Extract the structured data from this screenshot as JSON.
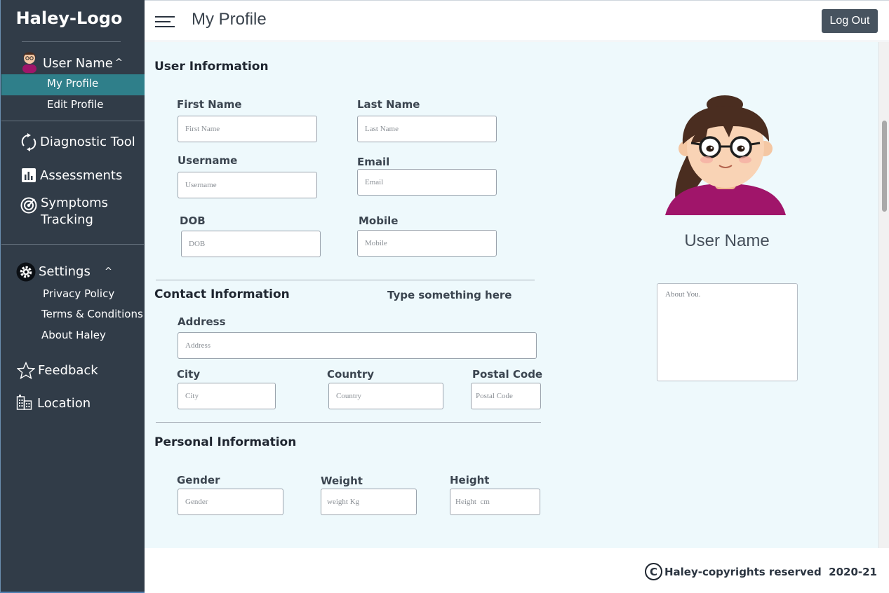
{
  "app": {
    "logo": "Haley-Logo"
  },
  "sidebar": {
    "user": {
      "name": "User Name",
      "caret": "^"
    },
    "profile_items": [
      {
        "label": "My Profile",
        "active": true
      },
      {
        "label": "Edit Profile",
        "active": false
      }
    ],
    "nav": [
      {
        "label": "Diagnostic Tool",
        "icon": "refresh-icon"
      },
      {
        "label": "Assessments",
        "icon": "bar-chart-icon"
      },
      {
        "label": "Symptoms",
        "icon": "radar-icon"
      },
      {
        "label": "Tracking"
      }
    ],
    "settings": {
      "label": "Settings",
      "caret": "^",
      "items": [
        {
          "label": "Privacy Policy"
        },
        {
          "label": "Terms & Conditions"
        },
        {
          "label": "About Haley"
        }
      ]
    },
    "feedback": {
      "label": "Feedback",
      "icon": "star-icon"
    },
    "location": {
      "label": "Location",
      "icon": "building-icon"
    }
  },
  "header": {
    "title": "My Profile",
    "logout_label": "Log Out",
    "menu_icon": "hamburger-icon"
  },
  "user_info": {
    "title": "User Information",
    "fields": {
      "first_name": {
        "label": "First Name",
        "placeholder": "First Name"
      },
      "last_name": {
        "label": "Last Name",
        "placeholder": "Last Name"
      },
      "username": {
        "label": "Username",
        "placeholder": "Username"
      },
      "email": {
        "label": "Email",
        "placeholder": "Email"
      },
      "dob": {
        "label": "DOB",
        "placeholder": "DOB"
      },
      "mobile": {
        "label": "Mobile",
        "placeholder": "Mobile"
      }
    }
  },
  "contact_info": {
    "title": "Contact Information",
    "hint": "Type something here",
    "fields": {
      "address": {
        "label": "Address",
        "placeholder": "Address"
      },
      "city": {
        "label": "City",
        "placeholder": "City"
      },
      "country": {
        "label": "Country",
        "placeholder": "Country"
      },
      "postal_code": {
        "label": "Postal Code",
        "placeholder": "Postal Code"
      }
    }
  },
  "personal_info": {
    "title": "Personal Information",
    "fields": {
      "gender": {
        "label": "Gender",
        "placeholder": "Gender"
      },
      "weight": {
        "label": "Weight",
        "placeholder": "weight Kg"
      },
      "height": {
        "label": "Height",
        "placeholder": "Height  cm"
      }
    }
  },
  "profile_card": {
    "user_name": "User Name",
    "about_placeholder": "About You."
  },
  "footer": {
    "copyright_symbol": "C",
    "text": "Haley-copyrights reserved  2020-21"
  },
  "colors": {
    "sidebar_bg": "#313c48",
    "active_item": "#2f7f8a",
    "main_bg": "#eef9fc",
    "logout_bg": "#47535f",
    "avatar_shirt": "#a0156a",
    "avatar_hair": "#4a2d20"
  }
}
